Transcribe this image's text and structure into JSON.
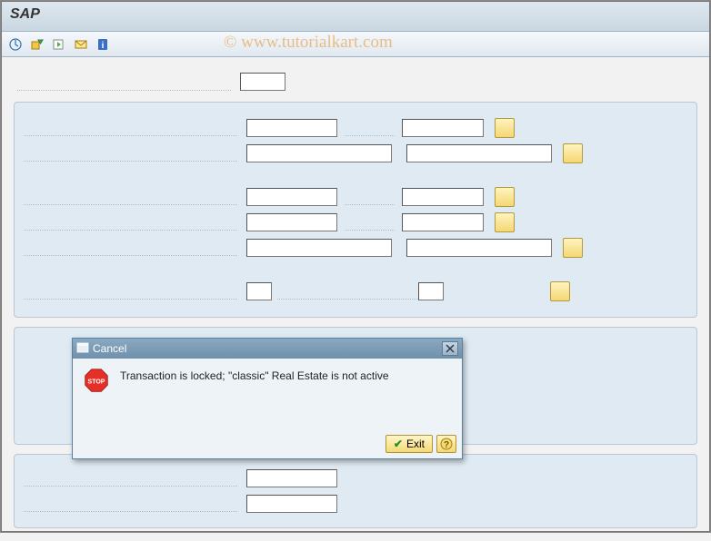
{
  "titlebar": {
    "title": "SAP"
  },
  "watermark": "© www.tutorialkart.com",
  "toolbar": {
    "icons": [
      {
        "name": "execute-icon"
      },
      {
        "name": "get-variant-icon"
      },
      {
        "name": "dynamic-selections-icon"
      },
      {
        "name": "mail-icon"
      },
      {
        "name": "info-icon"
      }
    ]
  },
  "dialog": {
    "title_icon": "window-icon",
    "title": "Cancel",
    "message": "Transaction is locked; \"classic\" Real Estate is not active",
    "exit_label": "Exit"
  }
}
